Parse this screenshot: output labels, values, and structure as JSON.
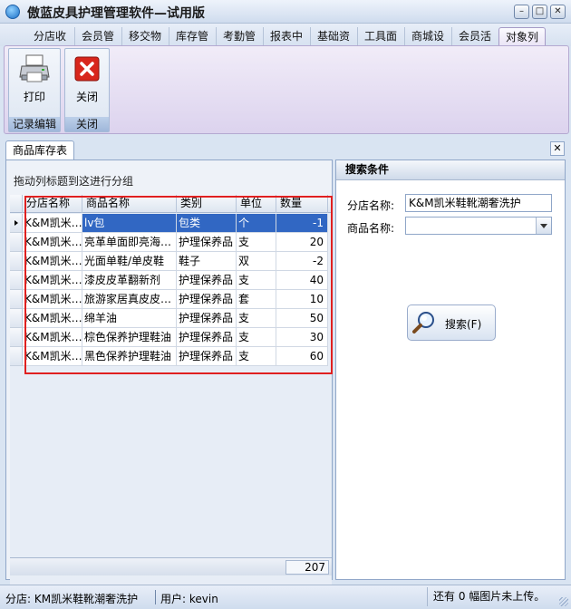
{
  "window": {
    "title": "傲蓝皮具护理管理软件—试用版",
    "controls": {
      "minimize": "–",
      "maximize": "□",
      "close": "✕"
    }
  },
  "tabs": [
    "分店收",
    "会员管",
    "移交物",
    "库存管",
    "考勤管",
    "报表中",
    "基础资",
    "工具面",
    "商城设",
    "会员活",
    "对象列"
  ],
  "active_tab": "对象列",
  "ribbon": {
    "groups": [
      {
        "label": "记录编辑",
        "buttons": [
          {
            "label": "打印",
            "icon": "printer-icon"
          }
        ]
      },
      {
        "label": "关闭",
        "buttons": [
          {
            "label": "关闭",
            "icon": "close-red-icon"
          }
        ]
      }
    ]
  },
  "document_tab": {
    "label": "商品库存表"
  },
  "grid": {
    "group_hint": "拖动列标题到这进行分组",
    "columns": [
      "分店名称",
      "商品名称",
      "类别",
      "单位",
      "数量"
    ],
    "rows": [
      [
        "K&M凯米…",
        "lv包",
        "包类",
        "个",
        "-1"
      ],
      [
        "K&M凯米…",
        "亮革单面即亮海…",
        "护理保养品",
        "支",
        "20"
      ],
      [
        "K&M凯米…",
        "光面单鞋/单皮鞋",
        "鞋子",
        "双",
        "-2"
      ],
      [
        "K&M凯米…",
        "漆皮皮革翻新剂",
        "护理保养品",
        "支",
        "40"
      ],
      [
        "K&M凯米…",
        "旅游家居真皮皮…",
        "护理保养品",
        "套",
        "10"
      ],
      [
        "K&M凯米…",
        "绵羊油",
        "护理保养品",
        "支",
        "50"
      ],
      [
        "K&M凯米…",
        "棕色保养护理鞋油",
        "护理保养品",
        "支",
        "30"
      ],
      [
        "K&M凯米…",
        "黑色保养护理鞋油",
        "护理保养品",
        "支",
        "60"
      ]
    ],
    "selected_row": 0,
    "total": "207"
  },
  "search": {
    "header": "搜索条件",
    "branch_label": "分店名称:",
    "branch_value": "K&M凯米鞋靴潮奢洗护",
    "product_label": "商品名称:",
    "product_value": "",
    "button_label": "搜索(F)"
  },
  "status": {
    "branch": "分店: KM凯米鞋靴潮奢洗护",
    "user": "用户: kevin",
    "message": "还有 0 幅图片未上传。"
  },
  "colors": {
    "selection": "#3167c3",
    "highlight_frame": "#e02020",
    "ribbon": "#dcd3ee"
  }
}
